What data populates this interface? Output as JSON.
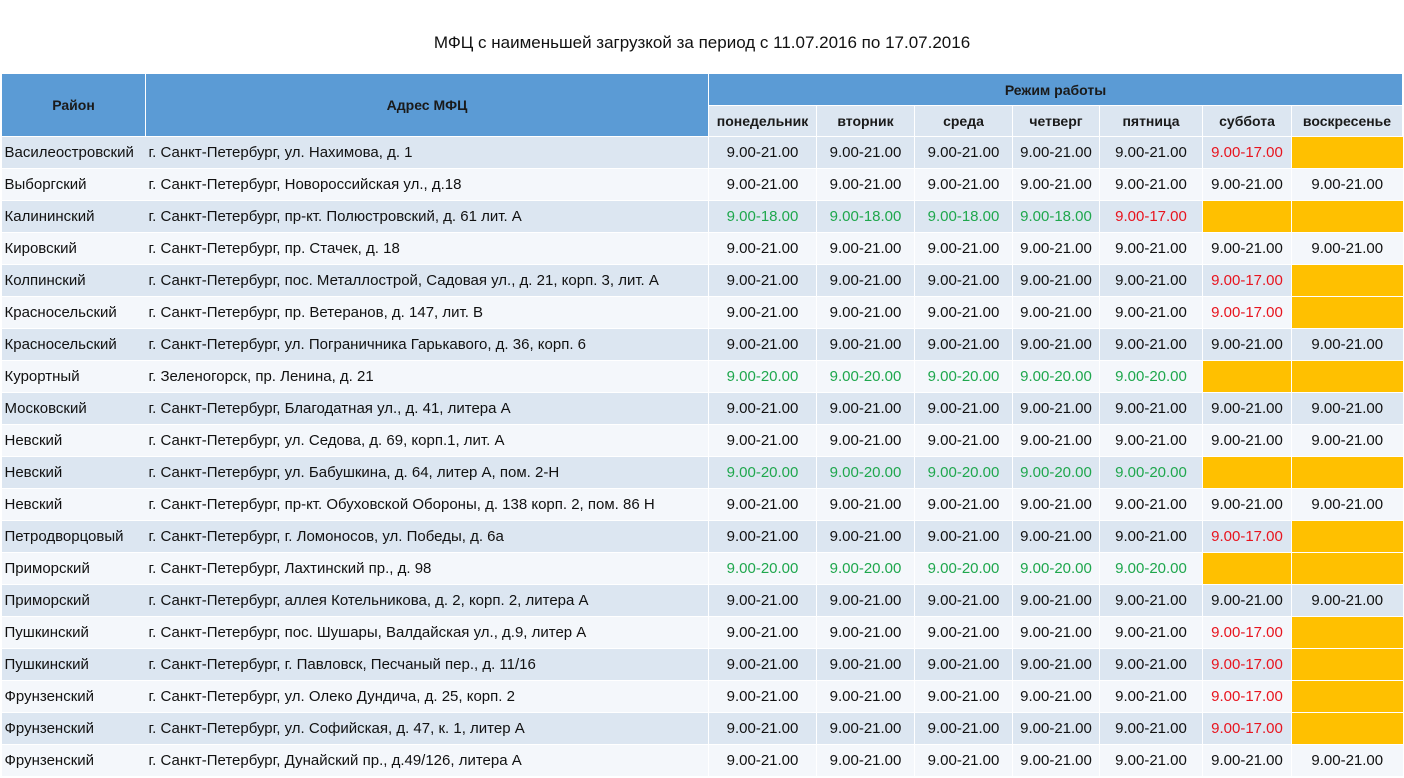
{
  "title": "МФЦ с наименьшей загрузкой за период с 11.07.2016 по 17.07.2016",
  "headers": {
    "district": "Район",
    "address": "Адрес МФЦ",
    "schedule": "Режим работы",
    "days": [
      "понедельник",
      "вторник",
      "среда",
      "четверг",
      "пятница",
      "суббота",
      "воскресенье"
    ]
  },
  "colors": {
    "header_blue": "#5b9bd5",
    "row_light": "#dce6f1",
    "green_text": "#1fa74d",
    "red_text": "#e8141e",
    "closed_yellow": "#ffc000"
  },
  "rows": [
    {
      "district": "Василеостровский",
      "address": "г. Санкт-Петербург, ул. Нахимова, д. 1",
      "days": [
        "9.00-21.00",
        "9.00-21.00",
        "9.00-21.00",
        "9.00-21.00",
        "9.00-21.00",
        "9.00-17.00",
        ""
      ],
      "styles": [
        "",
        "",
        "",
        "",
        "",
        "red",
        "yellow"
      ]
    },
    {
      "district": "Выборгский",
      "address": "г. Санкт-Петербург, Новороссийская ул., д.18",
      "days": [
        "9.00-21.00",
        "9.00-21.00",
        "9.00-21.00",
        "9.00-21.00",
        "9.00-21.00",
        "9.00-21.00",
        "9.00-21.00"
      ],
      "styles": [
        "",
        "",
        "",
        "",
        "",
        "",
        ""
      ]
    },
    {
      "district": "Калининский",
      "address": "г. Санкт-Петербург, пр-кт. Полюстровский, д. 61 лит. А",
      "days": [
        "9.00-18.00",
        "9.00-18.00",
        "9.00-18.00",
        "9.00-18.00",
        "9.00-17.00",
        "",
        ""
      ],
      "styles": [
        "green",
        "green",
        "green",
        "green",
        "red",
        "yellow",
        "yellow"
      ]
    },
    {
      "district": "Кировский",
      "address": "г. Санкт-Петербург, пр. Стачек, д. 18",
      "days": [
        "9.00-21.00",
        "9.00-21.00",
        "9.00-21.00",
        "9.00-21.00",
        "9.00-21.00",
        "9.00-21.00",
        "9.00-21.00"
      ],
      "styles": [
        "",
        "",
        "",
        "",
        "",
        "",
        ""
      ]
    },
    {
      "district": "Колпинский",
      "address": "г. Санкт-Петербург, пос. Металлострой, Садовая ул., д. 21, корп. 3, лит. А",
      "days": [
        "9.00-21.00",
        "9.00-21.00",
        "9.00-21.00",
        "9.00-21.00",
        "9.00-21.00",
        "9.00-17.00",
        ""
      ],
      "styles": [
        "",
        "",
        "",
        "",
        "",
        "red",
        "yellow"
      ]
    },
    {
      "district": "Красносельский",
      "address": "г. Санкт-Петербург, пр. Ветеранов, д. 147, лит. В",
      "days": [
        "9.00-21.00",
        "9.00-21.00",
        "9.00-21.00",
        "9.00-21.00",
        "9.00-21.00",
        "9.00-17.00",
        ""
      ],
      "styles": [
        "",
        "",
        "",
        "",
        "",
        "red",
        "yellow"
      ]
    },
    {
      "district": "Красносельский",
      "address": "г. Санкт-Петербург, ул. Пограничника Гарькавого, д. 36, корп. 6",
      "days": [
        "9.00-21.00",
        "9.00-21.00",
        "9.00-21.00",
        "9.00-21.00",
        "9.00-21.00",
        "9.00-21.00",
        "9.00-21.00"
      ],
      "styles": [
        "",
        "",
        "",
        "",
        "",
        "",
        ""
      ]
    },
    {
      "district": "Курортный",
      "address": "г. Зеленогорск, пр. Ленина, д. 21",
      "days": [
        "9.00-20.00",
        "9.00-20.00",
        "9.00-20.00",
        "9.00-20.00",
        "9.00-20.00",
        "",
        ""
      ],
      "styles": [
        "green",
        "green",
        "green",
        "green",
        "green",
        "yellow",
        "yellow"
      ]
    },
    {
      "district": "Московский",
      "address": " г. Санкт-Петербург, Благодатная ул., д. 41, литера А",
      "days": [
        "9.00-21.00",
        "9.00-21.00",
        "9.00-21.00",
        "9.00-21.00",
        "9.00-21.00",
        "9.00-21.00",
        "9.00-21.00"
      ],
      "styles": [
        "",
        "",
        "",
        "",
        "",
        "",
        ""
      ]
    },
    {
      "district": "Невский",
      "address": "г. Санкт-Петербург, ул. Седова, д. 69, корп.1, лит. А",
      "days": [
        "9.00-21.00",
        "9.00-21.00",
        "9.00-21.00",
        "9.00-21.00",
        "9.00-21.00",
        "9.00-21.00",
        "9.00-21.00"
      ],
      "styles": [
        "",
        "",
        "",
        "",
        "",
        "",
        ""
      ]
    },
    {
      "district": "Невский",
      "address": "г. Санкт-Петербург, ул. Бабушкина, д. 64, литер А, пом. 2-Н",
      "days": [
        "9.00-20.00",
        "9.00-20.00",
        "9.00-20.00",
        "9.00-20.00",
        "9.00-20.00",
        "",
        ""
      ],
      "styles": [
        "green",
        "green",
        "green",
        "green",
        "green",
        "yellow",
        "yellow"
      ]
    },
    {
      "district": "Невский",
      "address": "г. Санкт-Петербург, пр-кт. Обуховской Обороны, д. 138 корп. 2, пом. 86 Н",
      "days": [
        "9.00-21.00",
        "9.00-21.00",
        "9.00-21.00",
        "9.00-21.00",
        "9.00-21.00",
        "9.00-21.00",
        "9.00-21.00"
      ],
      "styles": [
        "",
        "",
        "",
        "",
        "",
        "",
        ""
      ]
    },
    {
      "district": "Петродворцовый",
      "address": "г. Санкт-Петербург, г. Ломоносов, ул. Победы, д. 6а",
      "days": [
        "9.00-21.00",
        "9.00-21.00",
        "9.00-21.00",
        "9.00-21.00",
        "9.00-21.00",
        "9.00-17.00",
        ""
      ],
      "styles": [
        "",
        "",
        "",
        "",
        "",
        "red",
        "yellow"
      ]
    },
    {
      "district": "Приморский",
      "address": "г. Санкт-Петербург, Лахтинский пр., д. 98",
      "days": [
        "9.00-20.00",
        "9.00-20.00",
        "9.00-20.00",
        "9.00-20.00",
        "9.00-20.00",
        "",
        ""
      ],
      "styles": [
        "green",
        "green",
        "green",
        "green",
        "green",
        "yellow",
        "yellow"
      ]
    },
    {
      "district": "Приморский",
      "address": "г. Санкт-Петербург, аллея Котельникова, д. 2, корп. 2, литера А",
      "days": [
        "9.00-21.00",
        "9.00-21.00",
        "9.00-21.00",
        "9.00-21.00",
        "9.00-21.00",
        "9.00-21.00",
        "9.00-21.00"
      ],
      "styles": [
        "",
        "",
        "",
        "",
        "",
        "",
        ""
      ]
    },
    {
      "district": "Пушкинский",
      "address": "г. Санкт-Петербург, пос. Шушары, Валдайская ул., д.9, литер А",
      "days": [
        "9.00-21.00",
        "9.00-21.00",
        "9.00-21.00",
        "9.00-21.00",
        "9.00-21.00",
        "9.00-17.00",
        ""
      ],
      "styles": [
        "",
        "",
        "",
        "",
        "",
        "red",
        "yellow"
      ]
    },
    {
      "district": "Пушкинский",
      "address": "г. Санкт-Петербург, г. Павловск, Песчаный пер., д. 11/16",
      "days": [
        "9.00-21.00",
        "9.00-21.00",
        "9.00-21.00",
        "9.00-21.00",
        "9.00-21.00",
        "9.00-17.00",
        ""
      ],
      "styles": [
        "",
        "",
        "",
        "",
        "",
        "red",
        "yellow"
      ]
    },
    {
      "district": "Фрунзенский",
      "address": "г. Санкт-Петербург, ул. Олеко Дундича, д. 25, корп. 2",
      "days": [
        "9.00-21.00",
        "9.00-21.00",
        "9.00-21.00",
        "9.00-21.00",
        "9.00-21.00",
        "9.00-17.00",
        ""
      ],
      "styles": [
        "",
        "",
        "",
        "",
        "",
        "red",
        "yellow"
      ]
    },
    {
      "district": "Фрунзенский",
      "address": "г. Санкт-Петербург, ул. Софийская, д. 47, к. 1, литер А",
      "days": [
        "9.00-21.00",
        "9.00-21.00",
        "9.00-21.00",
        "9.00-21.00",
        "9.00-21.00",
        "9.00-17.00",
        ""
      ],
      "styles": [
        "",
        "",
        "",
        "",
        "",
        "red",
        "yellow"
      ]
    },
    {
      "district": "Фрунзенский",
      "address": "г. Санкт-Петербург, Дунайский пр., д.49/126, литера А",
      "days": [
        "9.00-21.00",
        "9.00-21.00",
        "9.00-21.00",
        "9.00-21.00",
        "9.00-21.00",
        "9.00-21.00",
        "9.00-21.00"
      ],
      "styles": [
        "",
        "",
        "",
        "",
        "",
        "",
        ""
      ]
    }
  ]
}
